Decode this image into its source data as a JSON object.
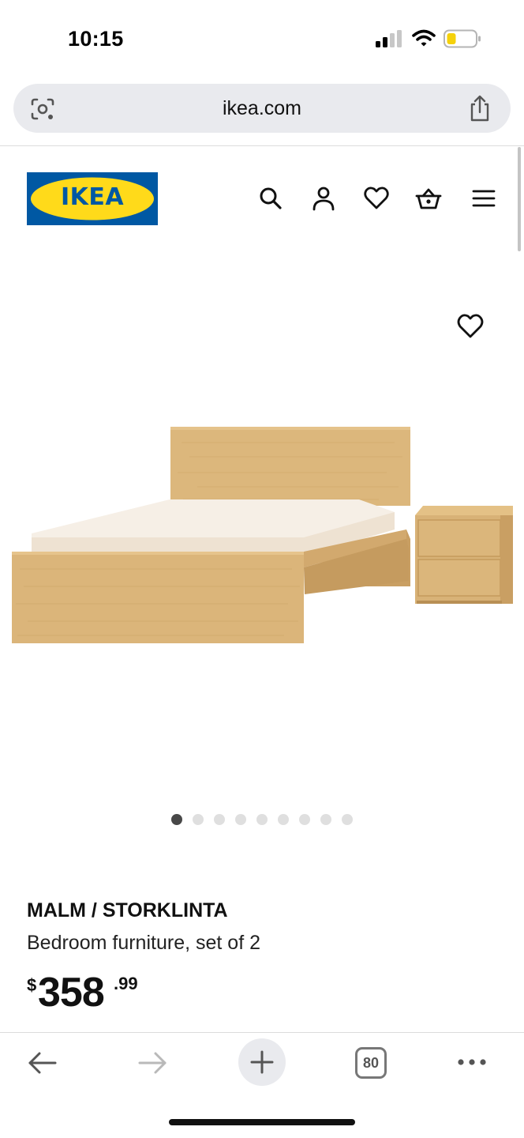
{
  "status_bar": {
    "time": "10:15",
    "icons": [
      "cellular-signal-icon",
      "wifi-icon",
      "battery-icon"
    ],
    "battery_color": "#f5d10b"
  },
  "browser": {
    "url": "ikea.com",
    "icons": [
      "lens-icon",
      "share-icon"
    ]
  },
  "header": {
    "logo_text": "IKEA",
    "logo_colors": {
      "blue": "#0058a3",
      "yellow": "#ffda1a"
    },
    "icons": [
      "search-icon",
      "profile-icon",
      "heart-icon",
      "basket-icon",
      "menu-icon"
    ]
  },
  "gallery": {
    "image_alt": "MALM / STORKLINTA bedroom furniture",
    "slide_count": 9,
    "active_slide": 1
  },
  "product": {
    "name": "MALM / STORKLINTA",
    "description": "Bedroom furniture, set of 2",
    "price_currency": "$",
    "price_main": "358",
    "price_cents": ".99"
  },
  "toolbar": {
    "tab_count": "80",
    "icons": [
      "back-arrow-icon",
      "forward-arrow-icon",
      "plus-icon",
      "tabs-icon",
      "more-icon"
    ]
  }
}
